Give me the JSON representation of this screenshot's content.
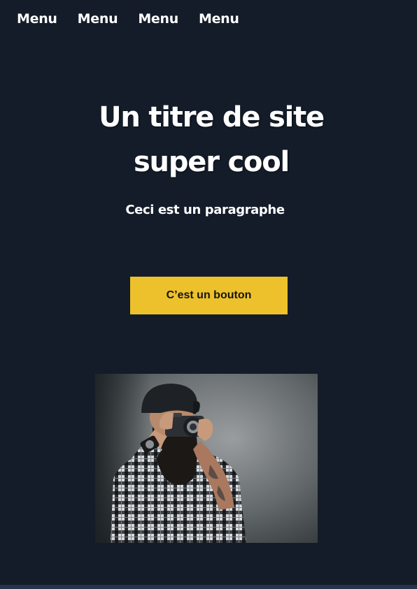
{
  "nav": {
    "items": [
      "Menu",
      "Menu",
      "Menu",
      "Menu"
    ]
  },
  "hero": {
    "title_line1": "Un titre de site",
    "title_line2": "super cool",
    "paragraph": "Ceci est un paragraphe",
    "button_label": "C’est un bouton"
  },
  "colors": {
    "background": "#141c29",
    "accent": "#edc12b",
    "text": "#ffffff"
  },
  "image": {
    "subject": "photographer-with-camera"
  }
}
